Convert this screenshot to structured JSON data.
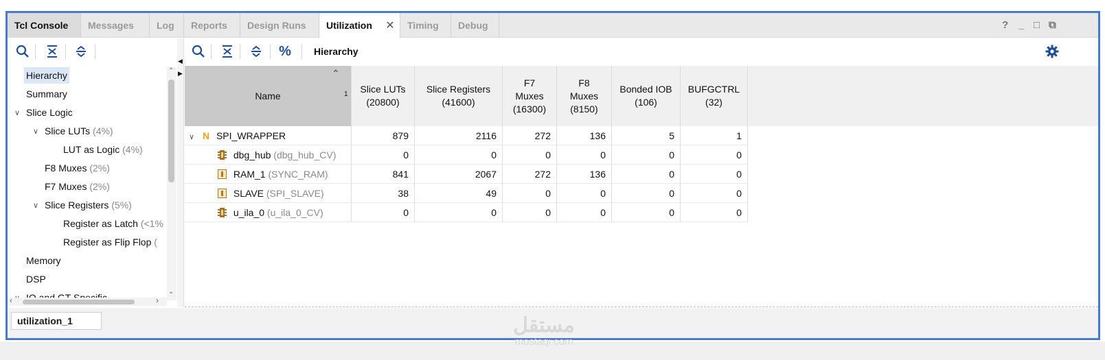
{
  "tabs": [
    {
      "label": "Tcl Console"
    },
    {
      "label": "Messages"
    },
    {
      "label": "Log"
    },
    {
      "label": "Reports"
    },
    {
      "label": "Design Runs"
    },
    {
      "label": "Utilization"
    },
    {
      "label": "Timing"
    },
    {
      "label": "Debug"
    }
  ],
  "active_tab": "Utilization",
  "window_controls": [
    "?",
    "_",
    "□",
    "⧉"
  ],
  "left_tree": [
    {
      "label": "Hierarchy",
      "pct": ""
    },
    {
      "label": "Summary",
      "pct": ""
    },
    {
      "label": "Slice Logic",
      "pct": ""
    },
    {
      "label": "Slice LUTs",
      "pct": " (4%)"
    },
    {
      "label": "LUT as Logic",
      "pct": " (4%)"
    },
    {
      "label": "F8 Muxes",
      "pct": " (2%)"
    },
    {
      "label": "F7 Muxes",
      "pct": " (2%)"
    },
    {
      "label": "Slice Registers",
      "pct": " (5%)"
    },
    {
      "label": "Register as Latch",
      "pct": " (<1%"
    },
    {
      "label": "Register as Flip Flop",
      "pct": " ("
    },
    {
      "label": "Memory",
      "pct": ""
    },
    {
      "label": "DSP",
      "pct": ""
    },
    {
      "label": "IO and GT Specific",
      "pct": ""
    }
  ],
  "right_toolbar": {
    "title": "Hierarchy"
  },
  "table": {
    "columns": [
      {
        "label": "Name",
        "sort_index": "1"
      },
      {
        "label": "Slice LUTs\n(20800)"
      },
      {
        "label": "Slice Registers\n(41600)"
      },
      {
        "label": "F7\nMuxes\n(16300)"
      },
      {
        "label": "F8\nMuxes\n(8150)"
      },
      {
        "label": "Bonded IOB\n(106)"
      },
      {
        "label": "BUFGCTRL\n(32)"
      }
    ],
    "rows": [
      {
        "name": "SPI_WRAPPER",
        "sub": "",
        "icon": "top-module-icon",
        "values": [
          "879",
          "2116",
          "272",
          "136",
          "5",
          "1"
        ]
      },
      {
        "name": "dbg_hub",
        "sub": " (dbg_hub_CV)",
        "icon": "debug-core-icon",
        "values": [
          "0",
          "0",
          "0",
          "0",
          "0",
          "0"
        ]
      },
      {
        "name": "RAM_1",
        "sub": " (SYNC_RAM)",
        "icon": "instance-icon",
        "values": [
          "841",
          "2067",
          "272",
          "136",
          "0",
          "0"
        ]
      },
      {
        "name": "SLAVE",
        "sub": " (SPI_SLAVE)",
        "icon": "instance-icon",
        "values": [
          "38",
          "49",
          "0",
          "0",
          "0",
          "0"
        ]
      },
      {
        "name": "u_ila_0",
        "sub": " (u_ila_0_CV)",
        "icon": "debug-core-icon",
        "values": [
          "0",
          "0",
          "0",
          "0",
          "0",
          "0"
        ]
      }
    ]
  },
  "bottom_tab": "utilization_1",
  "watermark": {
    "arabic": "مستقل",
    "latin": "mostaqi.com"
  },
  "colors": {
    "frame": "#4a7bc8",
    "icon_blue": "#1f4e94",
    "module_orange": "#e8a317",
    "selection": "#dbe6f7"
  }
}
